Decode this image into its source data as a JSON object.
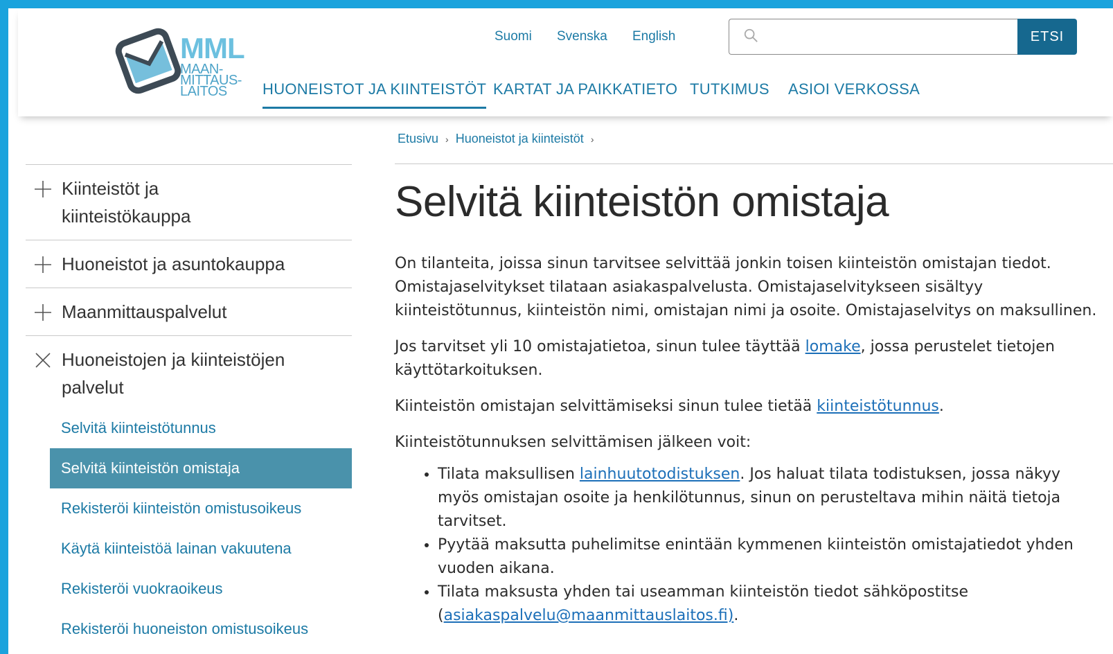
{
  "logo": {
    "big": "MML",
    "line1": "MAAN-",
    "line2": "MITTAUS-",
    "line3": "LAITOS"
  },
  "languages": [
    "Suomi",
    "Svenska",
    "English"
  ],
  "search": {
    "placeholder": "",
    "button": "ETSI"
  },
  "mainnav": [
    "HUONEISTOT JA KIINTEISTÖT",
    "KARTAT JA PAIKKATIETO",
    "TUTKIMUS",
    "ASIOI VERKOSSA"
  ],
  "breadcrumb": [
    "Etusivu",
    "Huoneistot ja kiinteistöt"
  ],
  "sidebar": {
    "sections": [
      {
        "line1": "Kiinteistöt ja",
        "line2": "kiinteistökauppa",
        "icon": "plus-icon"
      },
      {
        "line1": "Huoneistot ja asuntokauppa",
        "line2": "",
        "icon": "plus-icon"
      },
      {
        "line1": "Maanmittauspalvelut",
        "line2": "",
        "icon": "plus-icon"
      },
      {
        "line1": "Huoneistojen ja kiinteistöjen",
        "line2": "palvelut",
        "icon": "close-icon"
      }
    ],
    "sublinks": [
      "Selvitä kiinteistötunnus",
      "Selvitä kiinteistön omistaja",
      "Rekisteröi kiinteistön omistusoikeus",
      "Käytä kiinteistöä lainan vakuutena",
      "Rekisteröi vuokraoikeus",
      "Rekisteröi huoneiston omistusoikeus"
    ]
  },
  "page": {
    "title": "Selvitä kiinteistön omistaja",
    "p1_line1": "On tilanteita, joissa sinun tarvitsee selvittää jonkin toisen kiinteistön omistajan tiedot.",
    "p1_line2": "Omistajaselvitykset tilataan asiakaspalvelusta. Omistajaselvitykseen sisältyy",
    "p1_line3": "kiinteistötunnus, kiinteistön nimi, omistajan nimi ja osoite. Omistajaselvitys on maksullinen.",
    "p2_before": "Jos tarvitset yli 10 omistajatietoa, sinun tulee täyttää ",
    "p2_link": "lomake",
    "p2_after": ", jossa perustelet tietojen",
    "p2_line2": "käyttötarkoituksen.",
    "p3_before": "Kiinteistön omistajan selvittämiseksi sinun tulee tietää ",
    "p3_link": "kiinteistötunnus",
    "p3_after": ".",
    "p4": "Kiinteistötunnuksen selvittämisen jälkeen voit:",
    "li1_before": "Tilata maksullisen ",
    "li1_link": "lainhuutotodistuksen",
    "li1_after": ". Jos haluat tilata todistuksen, jossa näkyy",
    "li1_line2": "myös omistajan osoite ja henkilötunnus, sinun on perusteltava mihin näitä tietoja",
    "li1_line3": "tarvitset.",
    "li2_line1": "Pyytää maksutta puhelimitse enintään kymmenen kiinteistön omistajatiedot yhden",
    "li2_line2": "vuoden aikana.",
    "li3_line1": "Tilata maksusta yhden tai useamman kiinteistön tiedot sähköpostitse",
    "li3_open": "(",
    "li3_link": "asiakaspalvelu@maanmittauslaitos.fi)",
    "li3_after": "."
  },
  "colors": {
    "accent": "#1c7aa5",
    "frame": "#1aa3dd",
    "active_bg": "#4a92ab",
    "button": "#16688f"
  }
}
